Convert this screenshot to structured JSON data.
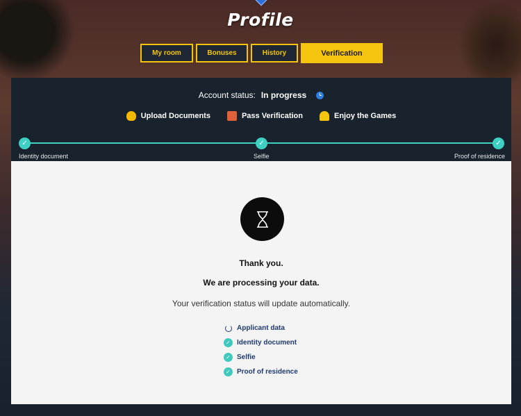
{
  "page": {
    "title": "Profile"
  },
  "tabs": [
    {
      "label": "My room",
      "active": false
    },
    {
      "label": "Bonuses",
      "active": false
    },
    {
      "label": "History",
      "active": false
    },
    {
      "label": "Verification",
      "active": true
    }
  ],
  "account_status": {
    "label": "Account status:",
    "value": "In progress",
    "icon": "clock-icon"
  },
  "steps": [
    {
      "label": "Upload Documents",
      "icon": "coins-icon"
    },
    {
      "label": "Pass Verification",
      "icon": "document-icon"
    },
    {
      "label": "Enjoy the Games",
      "icon": "user-icon"
    }
  ],
  "progress": [
    {
      "label": "Identity document",
      "done": true
    },
    {
      "label": "Selfie",
      "done": true
    },
    {
      "label": "Proof of residence",
      "done": true
    }
  ],
  "message": {
    "line1": "Thank you.",
    "line2": "We are processing your data.",
    "line3": "Your verification status will update automatically."
  },
  "checklist": [
    {
      "label": "Applicant data",
      "state": "pending"
    },
    {
      "label": "Identity document",
      "state": "done"
    },
    {
      "label": "Selfie",
      "state": "done"
    },
    {
      "label": "Proof of residence",
      "state": "done"
    }
  ],
  "colors": {
    "accent": "#f5c40f",
    "teal": "#3fd0c4",
    "panel": "#18232e",
    "link": "#1f3a6e"
  }
}
